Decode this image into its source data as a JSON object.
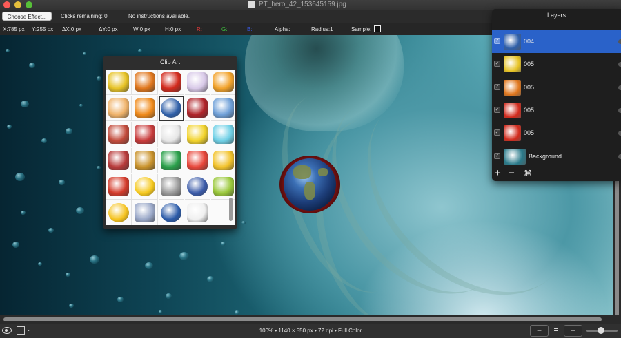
{
  "window": {
    "title": "PT_hero_42_153645159.jpg"
  },
  "toolbar": {
    "choose_effect": "Choose Effect...",
    "clicks_remaining": "Clicks remaining: 0",
    "instructions": "No instructions available."
  },
  "info": {
    "x": "X:785 px",
    "y": "Y:255 px",
    "dx": "ΔX:0 px",
    "dy": "ΔY:0 px",
    "w": "W:0 px",
    "h": "H:0 px",
    "r": "R:",
    "g": "G:",
    "b": "B:",
    "alpha": "Alpha:",
    "radius": "Radius:1",
    "sample": "Sample:"
  },
  "clipart": {
    "title": "Clip Art",
    "items": [
      {
        "name": "clip-yellow-car",
        "color": "#e7c325"
      },
      {
        "name": "clip-butterfly",
        "color": "#e0761c"
      },
      {
        "name": "clip-germany-flag",
        "color": "#d22a1c"
      },
      {
        "name": "clip-fairy",
        "color": "#d8c9e8"
      },
      {
        "name": "clip-orange-partial",
        "color": "#f2a22a"
      },
      {
        "name": "clip-girl",
        "color": "#f0b36a"
      },
      {
        "name": "clip-pencil-tool",
        "color": "#f08a1a"
      },
      {
        "name": "clip-earth",
        "color": "#2f5fa8"
      },
      {
        "name": "clip-motorcycle",
        "color": "#b0242a"
      },
      {
        "name": "clip-blue-partial",
        "color": "#6fa0d8"
      },
      {
        "name": "clip-flowerpot",
        "color": "#c24a3a"
      },
      {
        "name": "clip-bicycle",
        "color": "#c83a3a"
      },
      {
        "name": "clip-hamster",
        "color": "#e6e6e6"
      },
      {
        "name": "clip-rubber-duck",
        "color": "#f2d32c"
      },
      {
        "name": "clip-cyan-partial",
        "color": "#6fd0e6"
      },
      {
        "name": "clip-usa-flag",
        "color": "#b83a3a"
      },
      {
        "name": "clip-robot",
        "color": "#c9922a"
      },
      {
        "name": "clip-brazil-flag",
        "color": "#2aa04a"
      },
      {
        "name": "clip-cartoon-creature",
        "color": "#e8463a"
      },
      {
        "name": "clip-yellow-partial",
        "color": "#f2c22a"
      },
      {
        "name": "clip-mario",
        "color": "#d43a2a"
      },
      {
        "name": "clip-yellow-smiley",
        "color": "#f5c81c"
      },
      {
        "name": "clip-writing-desk",
        "color": "#9a9a9a"
      },
      {
        "name": "clip-vw-logo",
        "color": "#3a5aa8"
      },
      {
        "name": "clip-green-partial",
        "color": "#9ac83a"
      },
      {
        "name": "clip-laughing-smiley",
        "color": "#f5c21c"
      },
      {
        "name": "clip-paper-crane",
        "color": "#9aa8c8"
      },
      {
        "name": "clip-bmw-logo",
        "color": "#2a5aa8"
      },
      {
        "name": "clip-cartoon-dog",
        "color": "#f0f0f0"
      }
    ]
  },
  "layers": {
    "title": "Layers",
    "items": [
      {
        "label": "004",
        "selected": true,
        "thumb": "#2f5fa8"
      },
      {
        "label": "005",
        "selected": false,
        "thumb": "#e7c325"
      },
      {
        "label": "005",
        "selected": false,
        "thumb": "#e0761c"
      },
      {
        "label": "005",
        "selected": false,
        "thumb": "#d22a1c"
      },
      {
        "label": "005",
        "selected": false,
        "thumb": "#d22a1c"
      },
      {
        "label": "Background",
        "selected": false,
        "thumb": "#2a7a8a"
      }
    ],
    "tools": {
      "add": "+",
      "remove": "−",
      "merge": "⌘"
    }
  },
  "status": {
    "text": "100% • 1140 × 550 px • 72 dpi • Full Color",
    "zoom_out": "−",
    "zoom_fit": "=",
    "zoom_in": "+"
  },
  "colors": {
    "r_label": "#e33a3a",
    "g_label": "#3ec63e",
    "b_label": "#3a5ae8",
    "selection": "#2a62c9"
  }
}
